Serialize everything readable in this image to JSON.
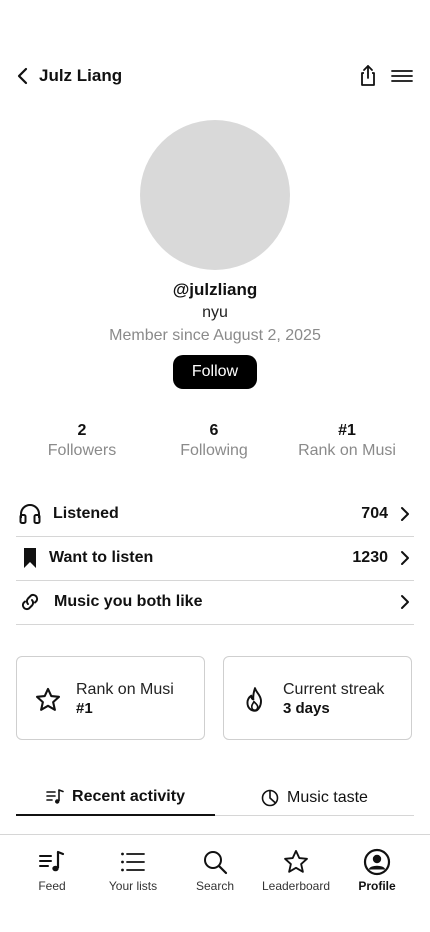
{
  "header": {
    "title": "Julz Liang",
    "icons": {
      "back": "chevron-left-icon",
      "share": "share-icon",
      "menu": "menu-icon"
    }
  },
  "profile": {
    "handle": "@julzliang",
    "school": "nyu",
    "member_since": "Member since August 2, 2025",
    "follow_label": "Follow"
  },
  "stats": [
    {
      "value": "2",
      "label": "Followers"
    },
    {
      "value": "6",
      "label": "Following"
    },
    {
      "value": "#1",
      "label": "Rank on Musi"
    }
  ],
  "rows": [
    {
      "label": "Listened",
      "count": "704",
      "icon": "headphones-icon"
    },
    {
      "label": "Want to listen",
      "count": "1230",
      "icon": "bookmark-icon"
    },
    {
      "label": "Music you both like",
      "count": "",
      "icon": "link-icon"
    }
  ],
  "cards": [
    {
      "title": "Rank on Musi",
      "value": "#1",
      "icon": "star-icon"
    },
    {
      "title": "Current streak",
      "value": "3 days",
      "icon": "flame-icon"
    }
  ],
  "tabs": [
    {
      "label": "Recent activity",
      "icon": "music-list-icon",
      "active": true
    },
    {
      "label": "Music taste",
      "icon": "pie-chart-icon",
      "active": false
    }
  ],
  "nav": [
    {
      "label": "Feed",
      "icon": "feed-icon"
    },
    {
      "label": "Your lists",
      "icon": "list-icon"
    },
    {
      "label": "Search",
      "icon": "search-icon"
    },
    {
      "label": "Leaderboard",
      "icon": "star-icon"
    },
    {
      "label": "Profile",
      "icon": "profile-icon",
      "active": true
    }
  ],
  "colors": {
    "accent": "#000000",
    "muted": "#8a8a8a",
    "avatar": "#d9d9d9",
    "divider": "#d6d6d6"
  }
}
